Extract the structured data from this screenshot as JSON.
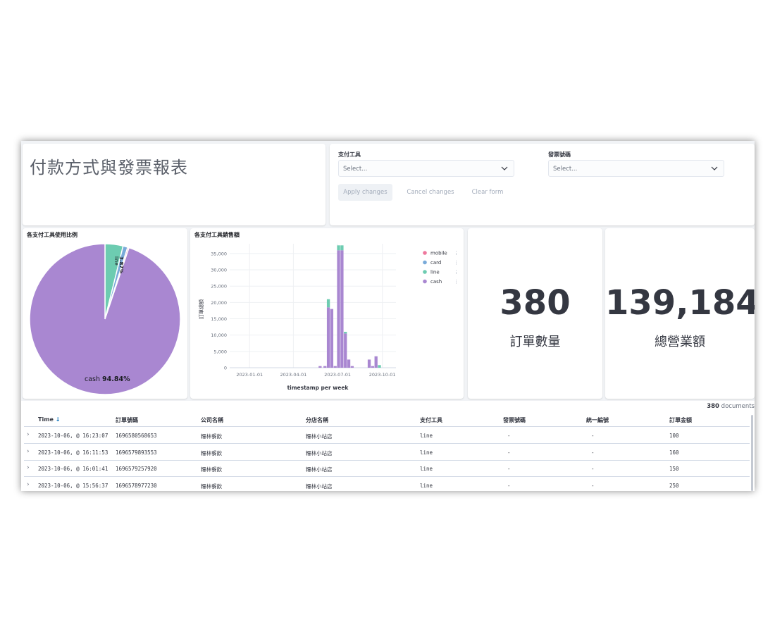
{
  "page": {
    "title": "付款方式與發票報表"
  },
  "controls": {
    "payment_label": "支付工具",
    "payment_placeholder": "Select...",
    "invoice_label": "發票號碼",
    "invoice_placeholder": "Select...",
    "apply_label": "Apply changes",
    "cancel_label": "Cancel changes",
    "clear_label": "Clear form"
  },
  "pie": {
    "title": "各支付工具使用比例",
    "cash_name": "cash",
    "cash_pct": "94.84%",
    "line_name": "line",
    "line_pct": "3.87%"
  },
  "bar": {
    "title": "各支付工具銷售額",
    "ylabel": "訂單總額",
    "xlabel": "timestamp per week"
  },
  "metrics": {
    "orders_value": "380",
    "orders_label": "訂單數量",
    "revenue_value": "139,184",
    "revenue_label": "總營業額"
  },
  "table": {
    "doc_count": "380",
    "doc_suffix": "documents",
    "headers": [
      "Time",
      "訂單號碼",
      "公司名稱",
      "分店名稱",
      "支付工具",
      "發票號碼",
      "統一編號",
      "訂單金額"
    ],
    "rows": [
      [
        "2023-10-06, @ 16:23:07",
        "1696580568653",
        "糧林餐飲",
        "糧林小站店",
        "line",
        "-",
        "-",
        "100"
      ],
      [
        "2023-10-06, @ 16:11:53",
        "1696579893553",
        "糧林餐飲",
        "糧林小站店",
        "line",
        "-",
        "-",
        "160"
      ],
      [
        "2023-10-06, @ 16:01:41",
        "1696579257920",
        "糧林餐飲",
        "糧林小站店",
        "line",
        "-",
        "-",
        "150"
      ],
      [
        "2023-10-06, @ 15:56:37",
        "1696578977230",
        "糧林餐飲",
        "糧林小站店",
        "line",
        "-",
        "-",
        "250"
      ]
    ]
  },
  "chart_data": [
    {
      "type": "pie",
      "title": "各支付工具使用比例",
      "labels": [
        "cash",
        "line",
        "card",
        "mobile"
      ],
      "values": [
        94.84,
        3.87,
        1.0,
        0.29
      ],
      "colors": [
        "#a987d1",
        "#6dccb1",
        "#79aad9",
        "#ee789d"
      ]
    },
    {
      "type": "bar",
      "stacked": true,
      "title": "各支付工具銷售額",
      "xlabel": "timestamp per week",
      "ylabel": "訂單總額",
      "ylim": [
        0,
        38000
      ],
      "yticks": [
        0,
        5000,
        10000,
        15000,
        20000,
        25000,
        30000,
        35000
      ],
      "ytick_labels": [
        "0",
        "5,000",
        "10,000",
        "15,000",
        "20,000",
        "25,000",
        "30,000",
        "35,000"
      ],
      "xticks": [
        "2023-01-01",
        "2023-04-01",
        "2023-07-01",
        "2023-10-01"
      ],
      "xlim": [
        "2022-11-21",
        "2023-10-29"
      ],
      "legend": [
        "mobile",
        "card",
        "line",
        "cash"
      ],
      "legend_position": "top-right",
      "colors": {
        "mobile": "#ee789d",
        "card": "#79aad9",
        "line": "#6dccb1",
        "cash": "#a987d1"
      },
      "series": [
        {
          "name": "cash",
          "x": [
            "2023-05-26",
            "2023-06-05",
            "2023-06-12",
            "2023-06-19",
            "2023-06-26",
            "2023-07-03",
            "2023-07-10",
            "2023-07-17",
            "2023-07-24",
            "2023-07-31",
            "2023-08-07",
            "2023-09-04",
            "2023-09-11",
            "2023-09-18",
            "2023-09-25"
          ],
          "values": [
            500,
            500,
            18500,
            18000,
            500,
            36000,
            36000,
            10500,
            2500,
            500,
            0,
            2500,
            500,
            3500,
            0
          ]
        },
        {
          "name": "line",
          "x": [
            "2023-05-26",
            "2023-06-05",
            "2023-06-12",
            "2023-06-19",
            "2023-06-26",
            "2023-07-03",
            "2023-07-10",
            "2023-07-17",
            "2023-07-24",
            "2023-07-31",
            "2023-08-07",
            "2023-09-04",
            "2023-09-11",
            "2023-09-18",
            "2023-09-25"
          ],
          "values": [
            0,
            0,
            2500,
            0,
            0,
            1500,
            1500,
            500,
            0,
            0,
            0,
            0,
            0,
            0,
            800
          ]
        }
      ]
    }
  ]
}
